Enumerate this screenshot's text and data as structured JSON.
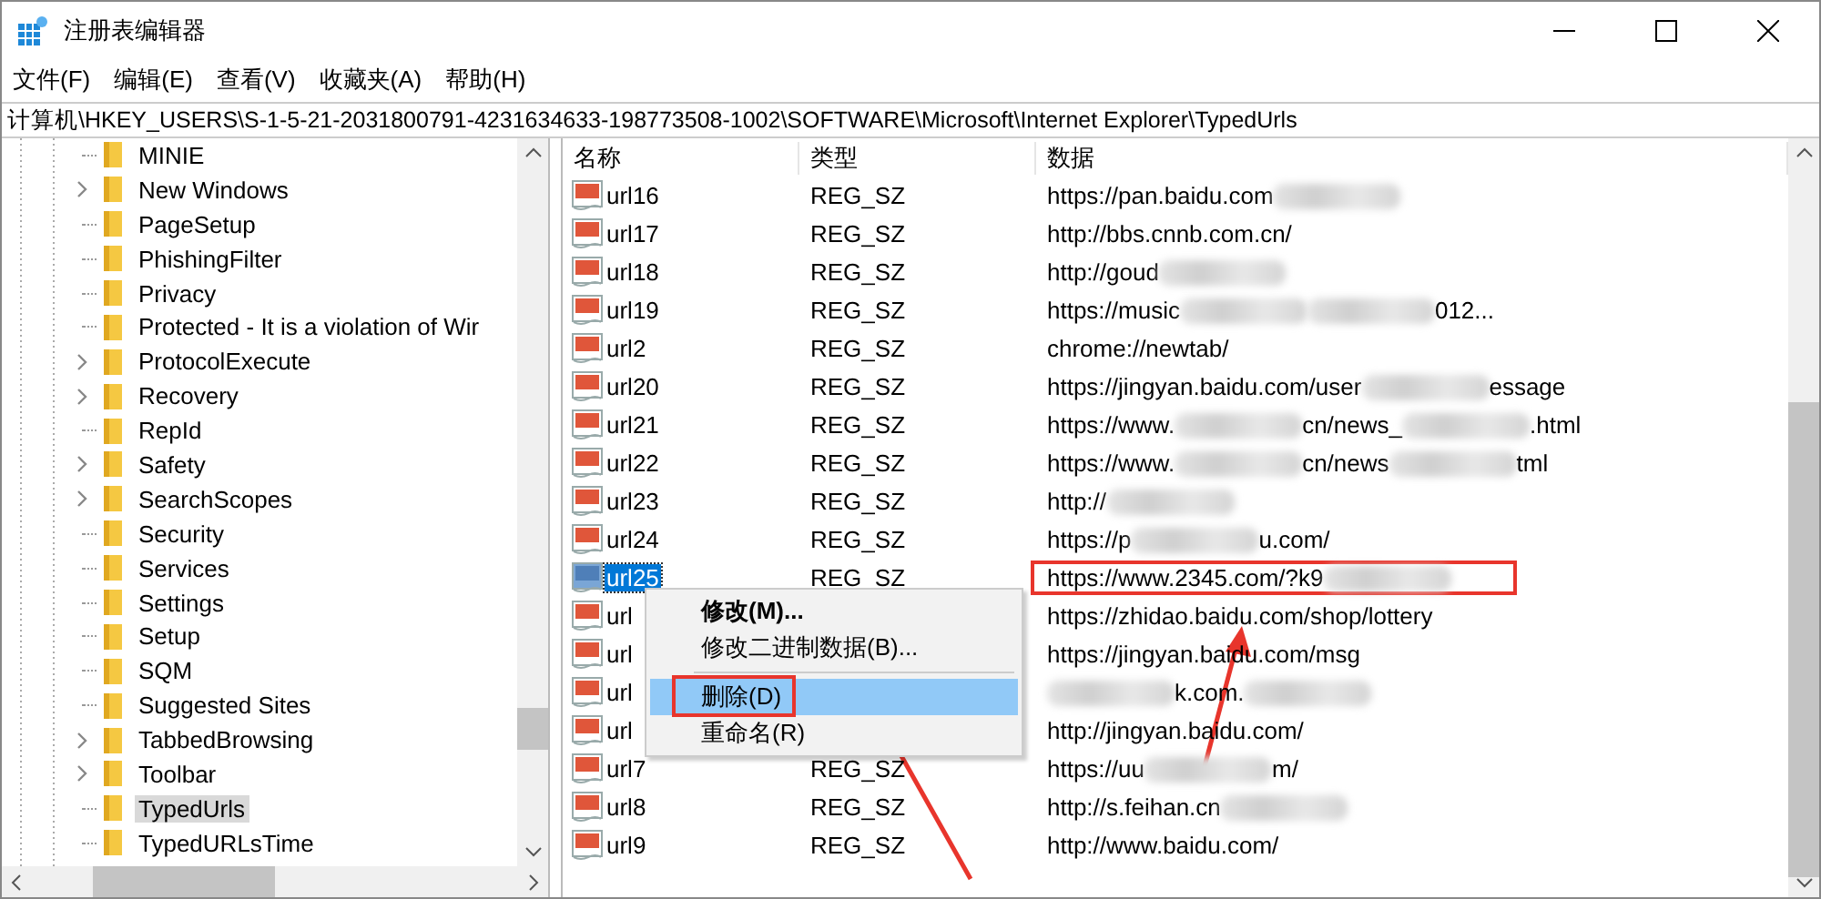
{
  "window": {
    "title": "注册表编辑器"
  },
  "menu": [
    {
      "label": "文件(F)"
    },
    {
      "label": "编辑(E)"
    },
    {
      "label": "查看(V)"
    },
    {
      "label": "收藏夹(A)"
    },
    {
      "label": "帮助(H)"
    }
  ],
  "address": "计算机\\HKEY_USERS\\S-1-5-21-2031800791-4231634633-198773508-1002\\SOFTWARE\\Microsoft\\Internet Explorer\\TypedUrls",
  "tree": [
    {
      "label": "MINIE",
      "expandable": false,
      "selected": false
    },
    {
      "label": "New Windows",
      "expandable": true,
      "selected": false
    },
    {
      "label": "PageSetup",
      "expandable": false,
      "selected": false
    },
    {
      "label": "PhishingFilter",
      "expandable": false,
      "selected": false
    },
    {
      "label": "Privacy",
      "expandable": false,
      "selected": false
    },
    {
      "label": "Protected - It is a violation of Wir",
      "expandable": false,
      "selected": false
    },
    {
      "label": "ProtocolExecute",
      "expandable": true,
      "selected": false
    },
    {
      "label": "Recovery",
      "expandable": true,
      "selected": false
    },
    {
      "label": "RepId",
      "expandable": false,
      "selected": false
    },
    {
      "label": "Safety",
      "expandable": true,
      "selected": false
    },
    {
      "label": "SearchScopes",
      "expandable": true,
      "selected": false
    },
    {
      "label": "Security",
      "expandable": false,
      "selected": false
    },
    {
      "label": "Services",
      "expandable": false,
      "selected": false
    },
    {
      "label": "Settings",
      "expandable": false,
      "selected": false
    },
    {
      "label": "Setup",
      "expandable": false,
      "selected": false
    },
    {
      "label": "SQM",
      "expandable": false,
      "selected": false
    },
    {
      "label": "Suggested Sites",
      "expandable": false,
      "selected": false
    },
    {
      "label": "TabbedBrowsing",
      "expandable": true,
      "selected": false
    },
    {
      "label": "Toolbar",
      "expandable": true,
      "selected": false
    },
    {
      "label": "TypedUrls",
      "expandable": false,
      "selected": true
    },
    {
      "label": "TypedURLsTime",
      "expandable": false,
      "selected": false
    }
  ],
  "columns": [
    "名称",
    "类型",
    "数据"
  ],
  "rows": [
    {
      "name": "url16",
      "type": "REG_SZ",
      "data": [
        {
          "kind": "text",
          "text": "https://pan.baidu.com"
        },
        {
          "kind": "blur"
        }
      ],
      "selected": false,
      "boxed": false
    },
    {
      "name": "url17",
      "type": "REG_SZ",
      "data": [
        {
          "kind": "text",
          "text": "http://bbs.cnnb.com.cn/"
        }
      ],
      "selected": false,
      "boxed": false
    },
    {
      "name": "url18",
      "type": "REG_SZ",
      "data": [
        {
          "kind": "text",
          "text": "http://goud"
        },
        {
          "kind": "blur"
        }
      ],
      "selected": false,
      "boxed": false
    },
    {
      "name": "url19",
      "type": "REG_SZ",
      "data": [
        {
          "kind": "text",
          "text": "https://music"
        },
        {
          "kind": "blur"
        },
        {
          "kind": "blur"
        },
        {
          "kind": "text",
          "text": "012..."
        }
      ],
      "selected": false,
      "boxed": false
    },
    {
      "name": "url2",
      "type": "REG_SZ",
      "data": [
        {
          "kind": "text",
          "text": "chrome://newtab/"
        }
      ],
      "selected": false,
      "boxed": false
    },
    {
      "name": "url20",
      "type": "REG_SZ",
      "data": [
        {
          "kind": "text",
          "text": "https://jingyan.baidu.com/user"
        },
        {
          "kind": "blur"
        },
        {
          "kind": "text",
          "text": "essage"
        }
      ],
      "selected": false,
      "boxed": false
    },
    {
      "name": "url21",
      "type": "REG_SZ",
      "data": [
        {
          "kind": "text",
          "text": "https://www."
        },
        {
          "kind": "blur"
        },
        {
          "kind": "text",
          "text": "cn/news_"
        },
        {
          "kind": "blur"
        },
        {
          "kind": "text",
          "text": ".html"
        }
      ],
      "selected": false,
      "boxed": false
    },
    {
      "name": "url22",
      "type": "REG_SZ",
      "data": [
        {
          "kind": "text",
          "text": "https://www."
        },
        {
          "kind": "blur"
        },
        {
          "kind": "text",
          "text": "cn/news"
        },
        {
          "kind": "blur"
        },
        {
          "kind": "text",
          "text": "tml"
        }
      ],
      "selected": false,
      "boxed": false
    },
    {
      "name": "url23",
      "type": "REG_SZ",
      "data": [
        {
          "kind": "text",
          "text": "http://"
        },
        {
          "kind": "blur"
        }
      ],
      "selected": false,
      "boxed": false
    },
    {
      "name": "url24",
      "type": "REG_SZ",
      "data": [
        {
          "kind": "text",
          "text": "https://p"
        },
        {
          "kind": "blur"
        },
        {
          "kind": "text",
          "text": "u.com/"
        }
      ],
      "selected": false,
      "boxed": false
    },
    {
      "name": "url25",
      "type": "REG_SZ",
      "data": [
        {
          "kind": "text",
          "text": "https://www.2345.com/?k9"
        },
        {
          "kind": "blur"
        }
      ],
      "selected": true,
      "boxed": true
    },
    {
      "name": "url",
      "data": [
        {
          "kind": "text",
          "text": "https://zhidao.baidu.com/shop/lottery"
        }
      ],
      "selected": false,
      "boxed": false
    },
    {
      "name": "url",
      "data": [
        {
          "kind": "text",
          "text": "https://jingyan.baidu.com/msg"
        }
      ],
      "selected": false,
      "boxed": false
    },
    {
      "name": "url",
      "data": [
        {
          "kind": "blur"
        },
        {
          "kind": "text",
          "text": "k.com."
        },
        {
          "kind": "blur"
        }
      ],
      "selected": false,
      "boxed": false
    },
    {
      "name": "url",
      "data": [
        {
          "kind": "text",
          "text": "http://jingyan.baidu.com/"
        }
      ],
      "selected": false,
      "boxed": false
    },
    {
      "name": "url7",
      "type": "REG_SZ",
      "data": [
        {
          "kind": "text",
          "text": "https://uu"
        },
        {
          "kind": "blur"
        },
        {
          "kind": "text",
          "text": "m/"
        }
      ],
      "selected": false,
      "boxed": false
    },
    {
      "name": "url8",
      "type": "REG_SZ",
      "data": [
        {
          "kind": "text",
          "text": "http://s.feihan.cn"
        },
        {
          "kind": "blur"
        }
      ],
      "selected": false,
      "boxed": false
    },
    {
      "name": "url9",
      "type": "REG_SZ",
      "data": [
        {
          "kind": "text",
          "text": "http://www.baidu.com/"
        }
      ],
      "selected": false,
      "boxed": false
    }
  ],
  "context_menu": {
    "items": [
      {
        "kind": "item",
        "label": "修改(M)...",
        "bold": true,
        "highlighted": false,
        "boxed": false
      },
      {
        "kind": "item",
        "label": "修改二进制数据(B)...",
        "bold": false,
        "highlighted": false,
        "boxed": false
      },
      {
        "kind": "separator"
      },
      {
        "kind": "item",
        "label": "删除(D)",
        "bold": false,
        "highlighted": true,
        "boxed": true
      },
      {
        "kind": "item",
        "label": "重命名(R)",
        "bold": false,
        "highlighted": false,
        "boxed": false
      }
    ]
  }
}
